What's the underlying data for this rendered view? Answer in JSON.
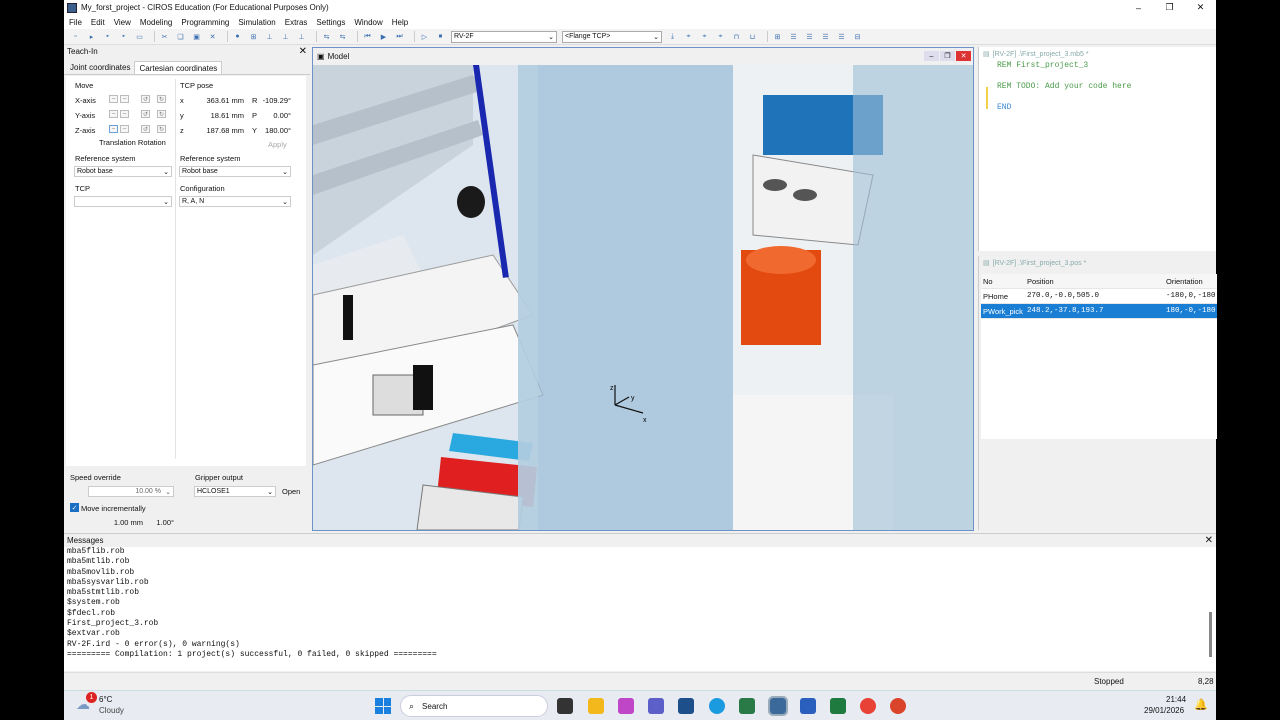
{
  "window": {
    "title": "My_forst_project - CIROS Education (For Educational Purposes Only)",
    "min": "–",
    "max": "❐",
    "close": "✕"
  },
  "menu": [
    "File",
    "Edit",
    "View",
    "Modeling",
    "Programming",
    "Simulation",
    "Extras",
    "Settings",
    "Window",
    "Help"
  ],
  "toolbar": {
    "robot_select": "RV-2F",
    "tcp_select": "<Flange TCP>"
  },
  "teach_in": {
    "title": "Teach-In",
    "tabs": [
      "Joint coordinates",
      "Cartesian coordinates"
    ],
    "active_tab": 1,
    "move_label": "Move",
    "axes": [
      "X-axis",
      "Y-axis",
      "Z-axis"
    ],
    "translation_rotation": "Translation Rotation",
    "tcp_pose_label": "TCP pose",
    "pose": [
      {
        "axis": "x",
        "value": "363.61 mm",
        "rot": "R",
        "rot_value": "-109.29°"
      },
      {
        "axis": "y",
        "value": "18.61 mm",
        "rot": "P",
        "rot_value": "0.00°"
      },
      {
        "axis": "z",
        "value": "187.68 mm",
        "rot": "Y",
        "rot_value": "180.00°"
      }
    ],
    "apply": "Apply",
    "ref_system_label": "Reference system",
    "ref_system_left": "Robot base",
    "ref_system_right": "Robot base",
    "tcp_label": "TCP",
    "tcp_value": "",
    "config_label": "Configuration",
    "config_value": "R, A, N",
    "speed_label": "Speed override",
    "speed_value": "10.00 %",
    "gripper_label": "Gripper output",
    "gripper_value": "HCLOSE1",
    "gripper_btn": "Open",
    "move_incr_label": "Move incrementally",
    "move_incr_checked": true,
    "incr_mm": "1.00 mm",
    "incr_deg": "1.00°"
  },
  "model": {
    "title": "Model"
  },
  "editor": {
    "title": "[RV-2F] .\\First_project_3.mb5 *",
    "lines": [
      "REM First_project_3",
      "",
      "REM TODO: Add your code here",
      "",
      "END"
    ]
  },
  "positions": {
    "title": "[RV-2F] .\\First_project_3.pos *",
    "headers": [
      "No",
      "Position",
      "Orientation"
    ],
    "rows": [
      {
        "no": "PHome",
        "pos": "270.0,-0.0,505.0",
        "ori": "-180,0,-180"
      },
      {
        "no": "PWork_pick",
        "pos": "248.2,-37.8,193.7",
        "ori": "180,-0,-180"
      }
    ]
  },
  "messages": {
    "title": "Messages",
    "lines": [
      "mba5flib.rob",
      "mba5mtlib.rob",
      "mba5movlib.rob",
      "mba5sysvarlib.rob",
      "mba5stmtlib.rob",
      "$system.rob",
      "$fdecl.rob",
      "First_project_3.rob",
      "$extvar.rob",
      "RV-2F.ird - 0 error(s), 0 warning(s)",
      "========= Compilation: 1 project(s) successful, 0 failed, 0 skipped ========="
    ]
  },
  "status": {
    "state": "Stopped",
    "value": "8,28"
  },
  "taskbar": {
    "temp": "6°C",
    "weather": "Cloudy",
    "badge": "1",
    "search": "Search",
    "time": "21:44",
    "date": "29/01/2026"
  }
}
